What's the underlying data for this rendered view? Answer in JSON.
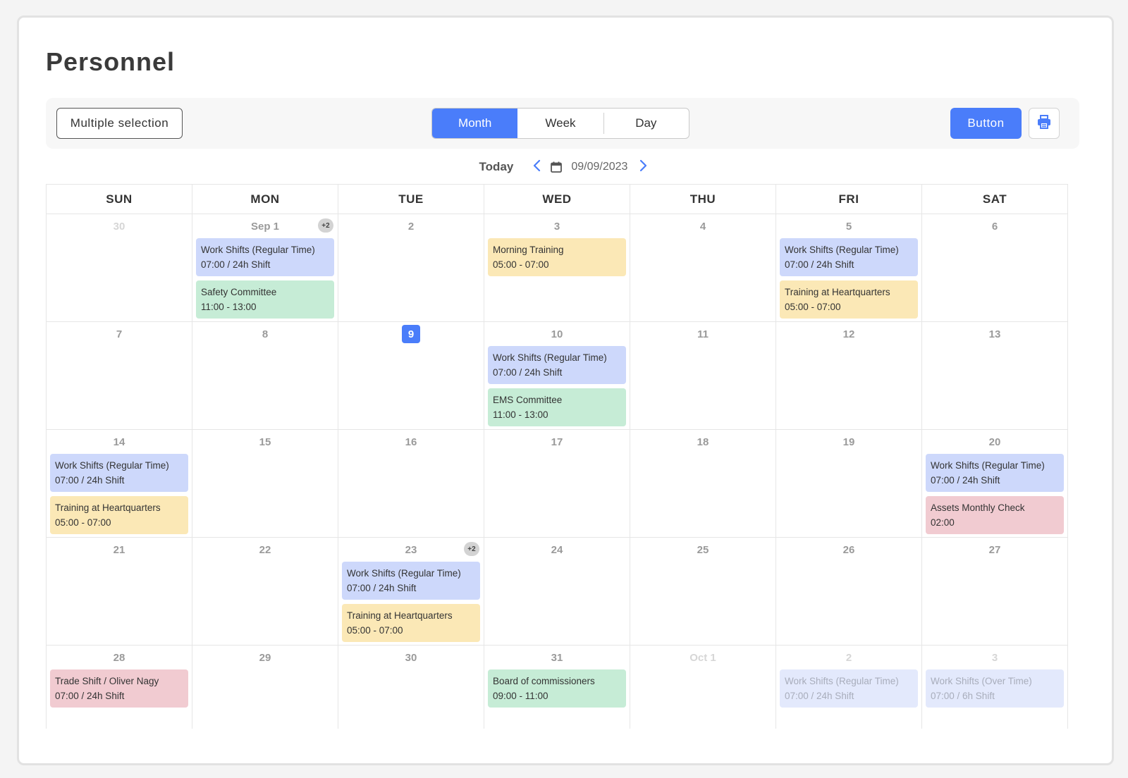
{
  "page": {
    "title": "Personnel"
  },
  "toolbar": {
    "multi_select_label": "Multiple selection",
    "views": [
      {
        "label": "Month",
        "active": true
      },
      {
        "label": "Week",
        "active": false
      },
      {
        "label": "Day",
        "active": false
      }
    ],
    "primary_button_label": "Button",
    "print_icon": "printer-icon"
  },
  "date_nav": {
    "today_label": "Today",
    "current_date": "09/09/2023",
    "prev_icon": "chevron-left-icon",
    "next_icon": "chevron-right-icon",
    "calendar_icon": "calendar-icon"
  },
  "colors": {
    "accent": "#4a7dfa",
    "blue_event": "#cdd8fb",
    "yellow_event": "#fbe8b6",
    "green_event": "#c6ecd6",
    "red_event": "#f1cbd1"
  },
  "calendar": {
    "weekdays": [
      "SUN",
      "MON",
      "TUE",
      "WED",
      "THU",
      "FRI",
      "SAT"
    ],
    "weeks": [
      {
        "days": [
          {
            "label": "30",
            "faded": true,
            "events": []
          },
          {
            "label": "Sep 1",
            "more": "+2",
            "events": [
              {
                "title": "Work Shifts (Regular Time)",
                "time": "07:00 / 24h Shift",
                "color": "blue"
              },
              {
                "title": "Safety Committee",
                "time": "11:00 - 13:00",
                "color": "green"
              }
            ]
          },
          {
            "label": "2",
            "events": []
          },
          {
            "label": "3",
            "events": [
              {
                "title": "Morning Training",
                "time": "05:00 - 07:00",
                "color": "yellow"
              }
            ]
          },
          {
            "label": "4",
            "events": []
          },
          {
            "label": "5",
            "events": [
              {
                "title": "Work Shifts (Regular Time)",
                "time": "07:00 / 24h Shift",
                "color": "blue"
              },
              {
                "title": "Training at Heartquarters",
                "time": "05:00 - 07:00",
                "color": "yellow"
              }
            ]
          },
          {
            "label": "6",
            "events": []
          }
        ]
      },
      {
        "days": [
          {
            "label": "7",
            "events": []
          },
          {
            "label": "8",
            "events": []
          },
          {
            "label": "9",
            "today": true,
            "events": []
          },
          {
            "label": "10",
            "events": [
              {
                "title": "Work Shifts (Regular Time)",
                "time": "07:00 / 24h Shift",
                "color": "blue"
              },
              {
                "title": "EMS Committee",
                "time": "11:00 - 13:00",
                "color": "green"
              }
            ]
          },
          {
            "label": "11",
            "events": []
          },
          {
            "label": "12",
            "events": []
          },
          {
            "label": "13",
            "events": []
          }
        ]
      },
      {
        "days": [
          {
            "label": "14",
            "events": [
              {
                "title": "Work Shifts (Regular Time)",
                "time": "07:00 / 24h Shift",
                "color": "blue"
              },
              {
                "title": "Training at Heartquarters",
                "time": "05:00 - 07:00",
                "color": "yellow"
              }
            ]
          },
          {
            "label": "15",
            "events": []
          },
          {
            "label": "16",
            "events": []
          },
          {
            "label": "17",
            "events": []
          },
          {
            "label": "18",
            "events": []
          },
          {
            "label": "19",
            "events": []
          },
          {
            "label": "20",
            "events": [
              {
                "title": "Work Shifts (Regular Time)",
                "time": "07:00 / 24h Shift",
                "color": "blue"
              },
              {
                "title": "Assets Monthly Check",
                "time": "02:00",
                "color": "red"
              }
            ]
          }
        ]
      },
      {
        "days": [
          {
            "label": "21",
            "events": []
          },
          {
            "label": "22",
            "events": []
          },
          {
            "label": "23",
            "more": "+2",
            "events": [
              {
                "title": "Work Shifts (Regular Time)",
                "time": "07:00 / 24h Shift",
                "color": "blue"
              },
              {
                "title": "Training at Heartquarters",
                "time": "05:00 - 07:00",
                "color": "yellow"
              }
            ]
          },
          {
            "label": "24",
            "events": []
          },
          {
            "label": "25",
            "events": []
          },
          {
            "label": "26",
            "events": []
          },
          {
            "label": "27",
            "events": []
          }
        ]
      },
      {
        "days": [
          {
            "label": "28",
            "events": [
              {
                "title": "Trade Shift / Oliver Nagy",
                "time": "07:00 / 24h Shift",
                "color": "red"
              }
            ]
          },
          {
            "label": "29",
            "events": []
          },
          {
            "label": "30",
            "events": []
          },
          {
            "label": "31",
            "events": [
              {
                "title": "Board of commissioners",
                "time": "09:00 - 11:00",
                "color": "green"
              }
            ]
          },
          {
            "label": "Oct 1",
            "faded": true,
            "events": []
          },
          {
            "label": "2",
            "faded": true,
            "events": [
              {
                "title": "Work Shifts (Regular Time)",
                "time": "07:00 / 24h Shift",
                "color": "faded"
              }
            ]
          },
          {
            "label": "3",
            "faded": true,
            "events": [
              {
                "title": "Work Shifts (Over Time)",
                "time": "07:00 / 6h Shift",
                "color": "faded"
              }
            ]
          }
        ]
      }
    ]
  }
}
